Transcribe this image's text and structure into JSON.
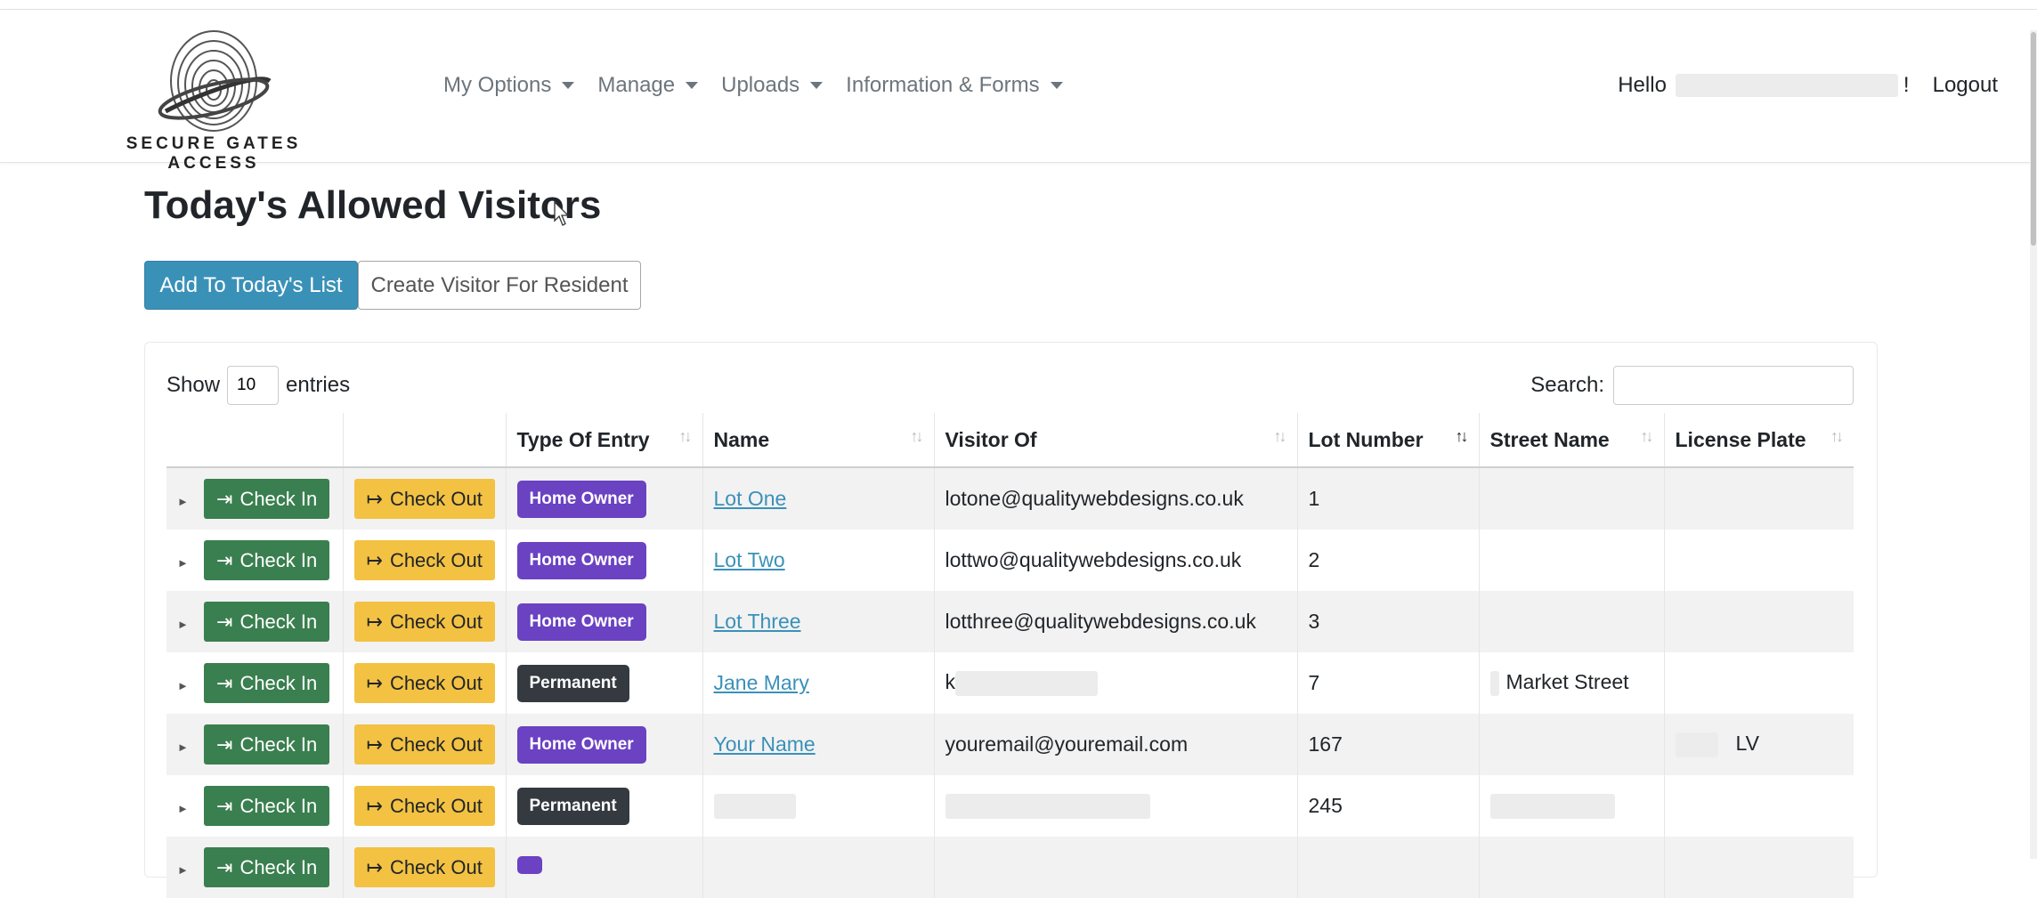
{
  "brand": {
    "logo_text": "SECURE GATES ACCESS"
  },
  "nav": {
    "menu": [
      "My Options",
      "Manage",
      "Uploads",
      "Information & Forms"
    ],
    "hello": "Hello",
    "exclaim": "!",
    "logout": "Logout"
  },
  "page": {
    "title": "Today's Allowed Visitors",
    "add_button": "Add To Today's List",
    "create_button": "Create Visitor For Resident"
  },
  "table_controls": {
    "show_label": "Show",
    "entries_value": "10",
    "entries_label": "entries",
    "search_label": "Search:"
  },
  "table": {
    "columns": [
      "",
      "",
      "Type Of Entry",
      "Name",
      "Visitor Of",
      "Lot Number",
      "Street Name",
      "License Plate"
    ],
    "checkin_label": "Check In",
    "checkout_label": "Check Out",
    "rows": [
      {
        "type": "Home Owner",
        "name": "Lot One",
        "visitor_of": "lotone@qualitywebdesigns.co.uk",
        "lot": "1",
        "street": "",
        "plate": ""
      },
      {
        "type": "Home Owner",
        "name": "Lot Two",
        "visitor_of": "lottwo@qualitywebdesigns.co.uk",
        "lot": "2",
        "street": "",
        "plate": ""
      },
      {
        "type": "Home Owner",
        "name": "Lot Three",
        "visitor_of": "lotthree@qualitywebdesigns.co.uk",
        "lot": "3",
        "street": "",
        "plate": ""
      },
      {
        "type": "Permanent",
        "name": "Jane Mary",
        "visitor_of": "k",
        "lot": "7",
        "street": "Market Street",
        "plate": ""
      },
      {
        "type": "Home Owner",
        "name": "Your Name",
        "visitor_of": "youremail@youremail.com",
        "lot": "167",
        "street": "",
        "plate": "LV"
      },
      {
        "type": "Permanent",
        "name": "",
        "visitor_of": "",
        "lot": "245",
        "street": "",
        "plate": ""
      }
    ]
  },
  "colors": {
    "primary": "#3a91b8",
    "checkin": "#3a7f4f",
    "checkout": "#f3c242",
    "home_owner": "#6a42c2",
    "permanent": "#343a40"
  },
  "icons": [
    "fingerprint-logo",
    "sign-in-icon",
    "sign-out-icon",
    "sort-icon",
    "expand-triangle-icon",
    "mouse-cursor-icon"
  ]
}
